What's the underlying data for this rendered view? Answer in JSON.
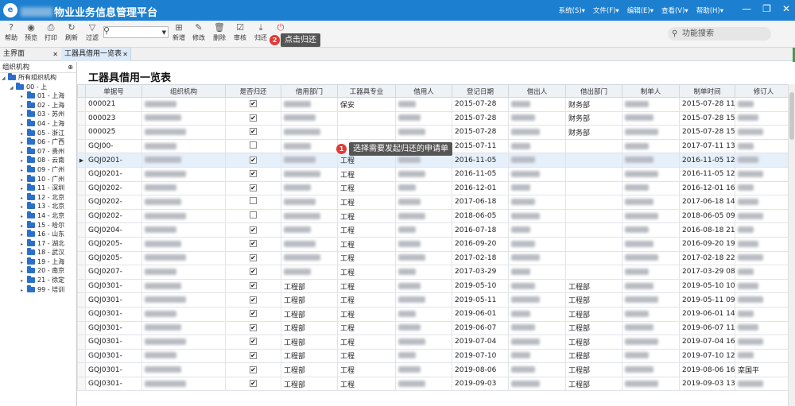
{
  "app": {
    "title": "物业业务信息管理平台",
    "logo_text": "e"
  },
  "menu": [
    "系统(S)▾",
    "文件(F)▾",
    "编辑(E)▾",
    "查看(V)▾",
    "帮助(H)▾"
  ],
  "window_controls": {
    "minimize": "—",
    "restore": "❐",
    "close": "✕"
  },
  "toolbar": {
    "buttons": [
      {
        "label": "帮助",
        "icon": "?"
      },
      {
        "label": "预览",
        "icon": "◉"
      },
      {
        "label": "打印",
        "icon": "⎙"
      },
      {
        "label": "刷新",
        "icon": "↻"
      },
      {
        "label": "过滤",
        "icon": "▽"
      },
      {
        "label": "新增",
        "icon": "⊞"
      },
      {
        "label": "修改",
        "icon": "✎"
      },
      {
        "label": "删除",
        "icon": "🗑"
      },
      {
        "label": "审核",
        "icon": "☑"
      },
      {
        "label": "归还",
        "icon": "⤓"
      },
      {
        "label": "",
        "icon": "⏻"
      }
    ],
    "func_search_placeholder": "功能搜索"
  },
  "callouts": [
    {
      "num": "2",
      "text": "点击归还"
    },
    {
      "num": "1",
      "text": "选择需要发起归还的申请单"
    }
  ],
  "tabs": [
    {
      "label": "主界面",
      "close": "✕"
    },
    {
      "label": "工器具借用一览表",
      "close": "✕"
    }
  ],
  "tree": {
    "header": "组织机构",
    "pin": "⊕",
    "root": "所有组织机构",
    "level1": "00 - 上",
    "items": [
      "01 - 上海",
      "02 - 上海",
      "03 - 苏州",
      "04 - 上海",
      "05 - 浙江",
      "06 - 广西",
      "07 - 贵州",
      "08 - 云南",
      "09 - 广州",
      "10 - 广州",
      "11 - 深圳",
      "12 - 北京",
      "13 - 北京",
      "14 - 北京",
      "15 - 哈尔",
      "16 - 山东",
      "17 - 湖北",
      "18 - 武汉",
      "19 - 上海",
      "20 - 南京",
      "21 - 徐定",
      "99 - 培训"
    ]
  },
  "page": {
    "title": "工器具借用一览表"
  },
  "table": {
    "columns": [
      "单据号",
      "组织机构",
      "是否归还",
      "借用部门",
      "工器具专业",
      "借用人",
      "登记日期",
      "借出人",
      "借出部门",
      "制单人",
      "制单时间",
      "修订人",
      "修"
    ],
    "rows": [
      [
        "000021",
        "",
        "✔",
        "",
        "保安",
        "",
        "2015-07-28",
        "",
        "财务部",
        "",
        "2015-07-28 11:",
        "",
        "2015"
      ],
      [
        "000023",
        "",
        "✔",
        "",
        "",
        "",
        "2015-07-28",
        "",
        "财务部",
        "",
        "2015-07-28 15:",
        "",
        "2015"
      ],
      [
        "000025",
        "",
        "✔",
        "",
        "",
        "",
        "2015-07-28",
        "",
        "财务部",
        "",
        "2015-07-28 15:",
        "",
        "2015"
      ],
      [
        "GQJ00-",
        "",
        "",
        "",
        "",
        "",
        "2015-07-11",
        "",
        "",
        "",
        "2017-07-11 13:",
        "",
        ""
      ],
      [
        "GQJ0201-",
        "",
        "✔",
        "",
        "工程",
        "",
        "2016-11-05",
        "",
        "",
        "",
        "2016-11-05 12:",
        "",
        "2016"
      ],
      [
        "GQJ0201-",
        "",
        "✔",
        "",
        "工程",
        "",
        "2016-11-05",
        "",
        "",
        "",
        "2016-11-05 12:",
        "",
        "2016"
      ],
      [
        "GQJ0202-",
        "",
        "✔",
        "",
        "工程",
        "",
        "2016-12-01",
        "",
        "",
        "",
        "2016-12-01 16:",
        "",
        ""
      ],
      [
        "GQJ0202-",
        "",
        "",
        "",
        "工程",
        "",
        "2017-06-18",
        "",
        "",
        "",
        "2017-06-18 14:",
        "",
        "2017"
      ],
      [
        "GQJ0202-",
        "",
        "",
        "",
        "工程",
        "",
        "2018-06-05",
        "",
        "",
        "",
        "2018-06-05 09:",
        "",
        "2018"
      ],
      [
        "GQJ0204-",
        "",
        "✔",
        "",
        "工程",
        "",
        "2016-07-18",
        "",
        "",
        "",
        "2016-08-18 21:",
        "",
        "2016"
      ],
      [
        "GQJ0205-",
        "",
        "✔",
        "",
        "工程",
        "",
        "2016-09-20",
        "",
        "",
        "",
        "2016-09-20 19:",
        "",
        "2016"
      ],
      [
        "GQJ0205-",
        "",
        "✔",
        "",
        "工程",
        "",
        "2017-02-18",
        "",
        "",
        "",
        "2017-02-18 22:",
        "",
        "2017"
      ],
      [
        "GQJ0207-",
        "",
        "✔",
        "",
        "工程",
        "",
        "2017-03-29",
        "",
        "",
        "",
        "2017-03-29 08:",
        "",
        "2017"
      ],
      [
        "GQJ0301-",
        "",
        "✔",
        "工程部",
        "工程",
        "",
        "2019-05-10",
        "",
        "工程部",
        "",
        "2019-05-10 10:",
        "",
        ""
      ],
      [
        "GQJ0301-",
        "",
        "✔",
        "工程部",
        "工程",
        "",
        "2019-05-11",
        "",
        "工程部",
        "",
        "2019-05-11 09:",
        "",
        ""
      ],
      [
        "GQJ0301-",
        "",
        "✔",
        "工程部",
        "工程",
        "",
        "2019-06-01",
        "",
        "工程部",
        "",
        "2019-06-01 14:",
        "",
        ""
      ],
      [
        "GQJ0301-",
        "",
        "✔",
        "工程部",
        "工程",
        "",
        "2019-06-07",
        "",
        "工程部",
        "",
        "2019-06-07 11:",
        "",
        ""
      ],
      [
        "GQJ0301-",
        "",
        "✔",
        "工程部",
        "工程",
        "",
        "2019-07-04",
        "",
        "工程部",
        "",
        "2019-07-04 16:",
        "",
        ""
      ],
      [
        "GQJ0301-",
        "",
        "✔",
        "工程部",
        "工程",
        "",
        "2019-07-10",
        "",
        "工程部",
        "",
        "2019-07-10 12:",
        "",
        ""
      ],
      [
        "GQJ0301-",
        "",
        "✔",
        "工程部",
        "工程",
        "",
        "2019-08-06",
        "",
        "工程部",
        "",
        "2019-08-06 16:",
        "栾国平",
        "2019"
      ],
      [
        "GQJ0301-",
        "",
        "✔",
        "工程部",
        "工程",
        "",
        "2019-09-03",
        "",
        "工程部",
        "",
        "2019-09-03 13:",
        "",
        ""
      ]
    ],
    "selected_row_indicator": "▶"
  }
}
